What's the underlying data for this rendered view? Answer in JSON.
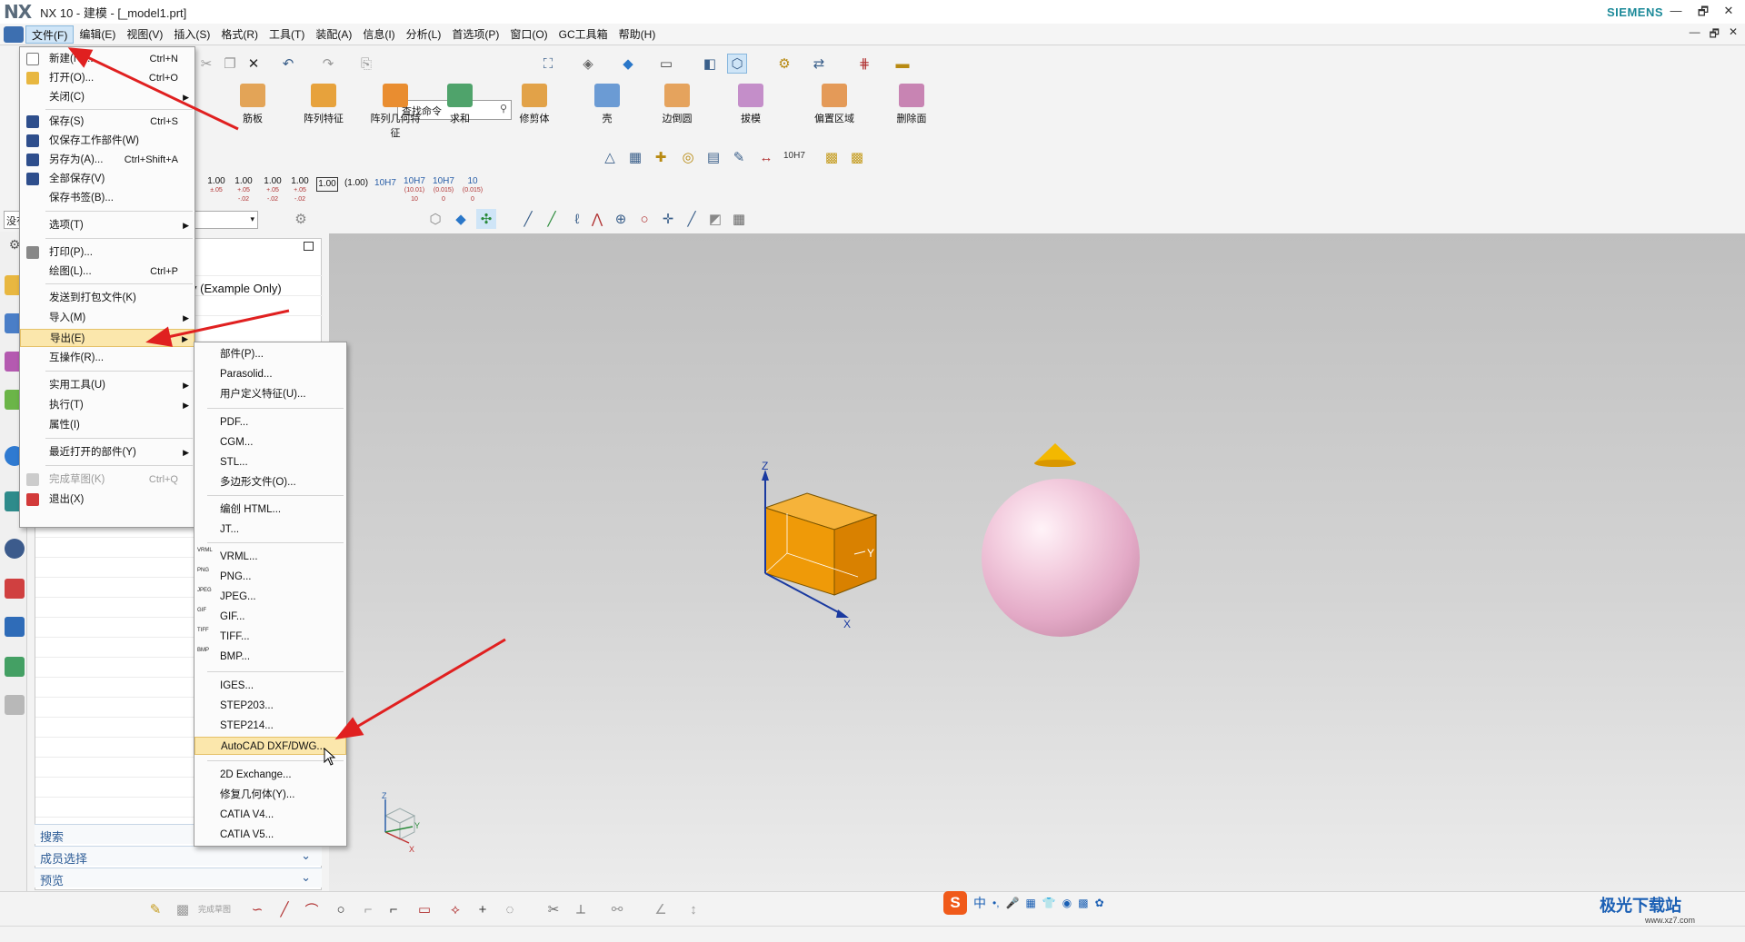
{
  "window": {
    "logo": "NX",
    "title": "NX 10 - 建模 - [_model1.prt]",
    "brand": "SIEMENS",
    "controls": [
      "—",
      "🗗",
      "✕"
    ],
    "doc_controls": [
      "—",
      "🗗",
      "✕"
    ]
  },
  "menubar": {
    "items": [
      "文件(F)",
      "编辑(E)",
      "视图(V)",
      "插入(S)",
      "格式(R)",
      "工具(T)",
      "装配(A)",
      "信息(I)",
      "分析(L)",
      "首选项(P)",
      "窗口(O)",
      "GC工具箱",
      "帮助(H)"
    ],
    "active": "文件(F)"
  },
  "toolbar": {
    "search_placeholder": "查找命令",
    "ribbon": [
      "筋板",
      "阵列特征",
      "阵列几何特征",
      "求和",
      "修剪体",
      "壳",
      "边倒圆",
      "拔模",
      "偏置区域",
      "删除面"
    ],
    "dims": [
      {
        "v": "1.00",
        "t": "±.05"
      },
      {
        "v": "1.00",
        "t": "+.05 -.02"
      },
      {
        "v": "1.00",
        "t": "+.05 -.02"
      },
      {
        "v": "1.00",
        "t": "+.05 -.02"
      },
      {
        "v": "1.00",
        "t": ""
      },
      {
        "v": "(1.00)",
        "t": ""
      },
      {
        "v": "10H7",
        "t": ""
      },
      {
        "v": "10H7",
        "t": "(10.01) 10"
      },
      {
        "v": "10H7",
        "t": "(0.015) 0"
      },
      {
        "v": "10",
        "t": "(0.015) 0"
      }
    ],
    "tol_label": "10H7",
    "filter_left": "没有"
  },
  "file_menu": {
    "items": [
      {
        "label": "新建(N)...",
        "shortcut": "Ctrl+N"
      },
      {
        "label": "打开(O)...",
        "shortcut": "Ctrl+O"
      },
      {
        "label": "关闭(C)",
        "shortcut": ""
      },
      {
        "label": "保存(S)",
        "shortcut": "Ctrl+S"
      },
      {
        "label": "仅保存工作部件(W)",
        "shortcut": ""
      },
      {
        "label": "另存为(A)...",
        "shortcut": "Ctrl+Shift+A"
      },
      {
        "label": "全部保存(V)",
        "shortcut": ""
      },
      {
        "label": "保存书签(B)...",
        "shortcut": ""
      },
      {
        "label": "选项(T)",
        "shortcut": ""
      },
      {
        "label": "打印(P)...",
        "shortcut": ""
      },
      {
        "label": "绘图(L)...",
        "shortcut": "Ctrl+P"
      },
      {
        "label": "发送到打包文件(K)",
        "shortcut": ""
      },
      {
        "label": "导入(M)",
        "shortcut": ""
      },
      {
        "label": "导出(E)",
        "shortcut": ""
      },
      {
        "label": "互操作(R)...",
        "shortcut": ""
      },
      {
        "label": "实用工具(U)",
        "shortcut": ""
      },
      {
        "label": "执行(T)",
        "shortcut": ""
      },
      {
        "label": "属性(I)",
        "shortcut": ""
      },
      {
        "label": "最近打开的部件(Y)",
        "shortcut": ""
      },
      {
        "label": "完成草图(K)",
        "shortcut": "Ctrl+Q"
      },
      {
        "label": "退出(X)",
        "shortcut": ""
      }
    ]
  },
  "export_menu": {
    "items": [
      {
        "label": "部件(P)...",
        "tag": ""
      },
      {
        "label": "Parasolid...",
        "tag": ""
      },
      {
        "label": "用户定义特征(U)...",
        "tag": ""
      },
      {
        "label": "PDF...",
        "tag": ""
      },
      {
        "label": "CGM...",
        "tag": ""
      },
      {
        "label": "STL...",
        "tag": ""
      },
      {
        "label": "多边形文件(O)...",
        "tag": ""
      },
      {
        "label": "编创 HTML...",
        "tag": ""
      },
      {
        "label": "JT...",
        "tag": ""
      },
      {
        "label": "VRML...",
        "tag": "VRML"
      },
      {
        "label": "PNG...",
        "tag": "PNG"
      },
      {
        "label": "JPEG...",
        "tag": "JPEG"
      },
      {
        "label": "GIF...",
        "tag": "GIF"
      },
      {
        "label": "TIFF...",
        "tag": "TIFF"
      },
      {
        "label": "BMP...",
        "tag": "BMP"
      },
      {
        "label": "IGES...",
        "tag": ""
      },
      {
        "label": "STEP203...",
        "tag": ""
      },
      {
        "label": "STEP214...",
        "tag": ""
      },
      {
        "label": "AutoCAD DXF/DWG...",
        "tag": ""
      },
      {
        "label": "2D Exchange...",
        "tag": ""
      },
      {
        "label": "修复几何体(Y)...",
        "tag": ""
      },
      {
        "label": "CATIA V4...",
        "tag": ""
      },
      {
        "label": "CATIA V5...",
        "tag": ""
      }
    ]
  },
  "navigator": {
    "example_label": "y (Example Only)",
    "footer": [
      "搜索",
      "成员选择",
      "预览"
    ]
  },
  "viewport": {
    "axis_labels": {
      "z": "Z",
      "y": "Y",
      "x": "X"
    },
    "triad_labels": {
      "z": "Z",
      "y": "Y",
      "x": "X"
    }
  },
  "bottom": {
    "sketch_label": "完成草图",
    "ime": [
      "中",
      "•,",
      "🎤",
      "▦",
      "👕",
      "◉",
      "▩",
      "✿"
    ],
    "watermark": "极光下载站",
    "watermark_url": "www.xz7.com"
  },
  "colors": {
    "accent": "#1c8a99",
    "highlight": "#fbe7ac",
    "arrow": "#e02020",
    "block": "#f0a30a"
  }
}
